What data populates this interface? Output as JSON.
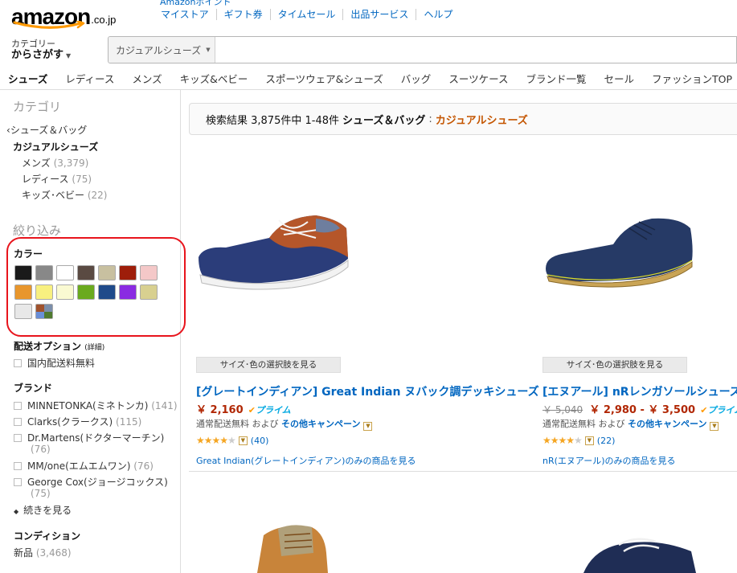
{
  "header": {
    "logo_text": "amazon",
    "logo_tld": ".co.jp",
    "promo_text": "Amazonポイント",
    "nav_links": [
      "マイストア",
      "ギフト券",
      "タイムセール",
      "出品サービス",
      "ヘルプ"
    ]
  },
  "browse": {
    "line1": "カテゴリー",
    "line2": "からさがす"
  },
  "search": {
    "dropdown_value": "カジュアルシューズ"
  },
  "catnav": [
    "シューズ",
    "レディース",
    "メンズ",
    "キッズ&ベビー",
    "スポーツウェア&シューズ",
    "バッグ",
    "スーツケース",
    "ブランド一覧",
    "セール",
    "ファッションTOP"
  ],
  "sidebar": {
    "category_title": "カテゴリ",
    "back_link": "シューズ＆バッグ",
    "current_category": "カジュアルシューズ",
    "subcats": [
      {
        "label": "メンズ",
        "count": "(3,379)"
      },
      {
        "label": "レディース",
        "count": "(75)"
      },
      {
        "label": "キッズ･ベビー",
        "count": "(22)"
      }
    ],
    "refine_title": "絞り込み",
    "color_title": "カラー",
    "colors": [
      "#1a1a1a",
      "#888888",
      "#ffffff",
      "#5a4a42",
      "#c8c0a0",
      "#9e1e0a",
      "#f4c8c8",
      "#e8962c",
      "#f8f080",
      "#fafad2",
      "#6aaa1e",
      "#1f4a8a",
      "#8a2be2",
      "#d8d090",
      "#e8e8e8",
      "multi"
    ],
    "delivery_title": "配送オプション",
    "delivery_note": "(詳細)",
    "delivery_option": "国内配送料無料",
    "brand_title": "ブランド",
    "brands": [
      {
        "label": "MINNETONKA(ミネトンカ)",
        "count": "(141)"
      },
      {
        "label": "Clarks(クラークス)",
        "count": "(115)"
      },
      {
        "label": "Dr.Martens(ドクターマーチン)",
        "count": "(76)"
      },
      {
        "label": "MM/one(エムエムワン)",
        "count": "(76)"
      },
      {
        "label": "George Cox(ジョージコックス)",
        "count": "(75)"
      }
    ],
    "see_more": "続きを見る",
    "condition_title": "コンディション",
    "condition_item": "新品",
    "condition_count": "(3,468)"
  },
  "results": {
    "prefix": "検索結果 3,875件中 1-48件",
    "category": "シューズ＆バッグ",
    "separator": ":",
    "subcategory": "カジュアルシューズ"
  },
  "products": [
    {
      "option_button": "サイズ･色の選択肢を見る",
      "title": "[グレートインディアン] Great Indian ヌバック調デッキシューズ",
      "old_price": "",
      "price": "￥ 2,160",
      "prime_label": "プライム",
      "shipping": "通常配送無料 および",
      "campaign": "その他キャンペーン",
      "rating": 3.5,
      "review_count": "(40)",
      "brand_link": "Great Indian(グレートインディアン)のみの商品を見る"
    },
    {
      "option_button": "サイズ･色の選択肢を見る",
      "title": "[エヌアール] nRレンガソールシューズ",
      "old_price": "￥ 5,040",
      "price": "￥ 2,980 - ￥ 3,500",
      "prime_label": "プライム",
      "shipping": "通常配送無料 および",
      "campaign": "その他キャンペーン",
      "rating": 3.5,
      "review_count": "(22)",
      "brand_link": "nR(エヌアール)のみの商品を見る"
    }
  ]
}
